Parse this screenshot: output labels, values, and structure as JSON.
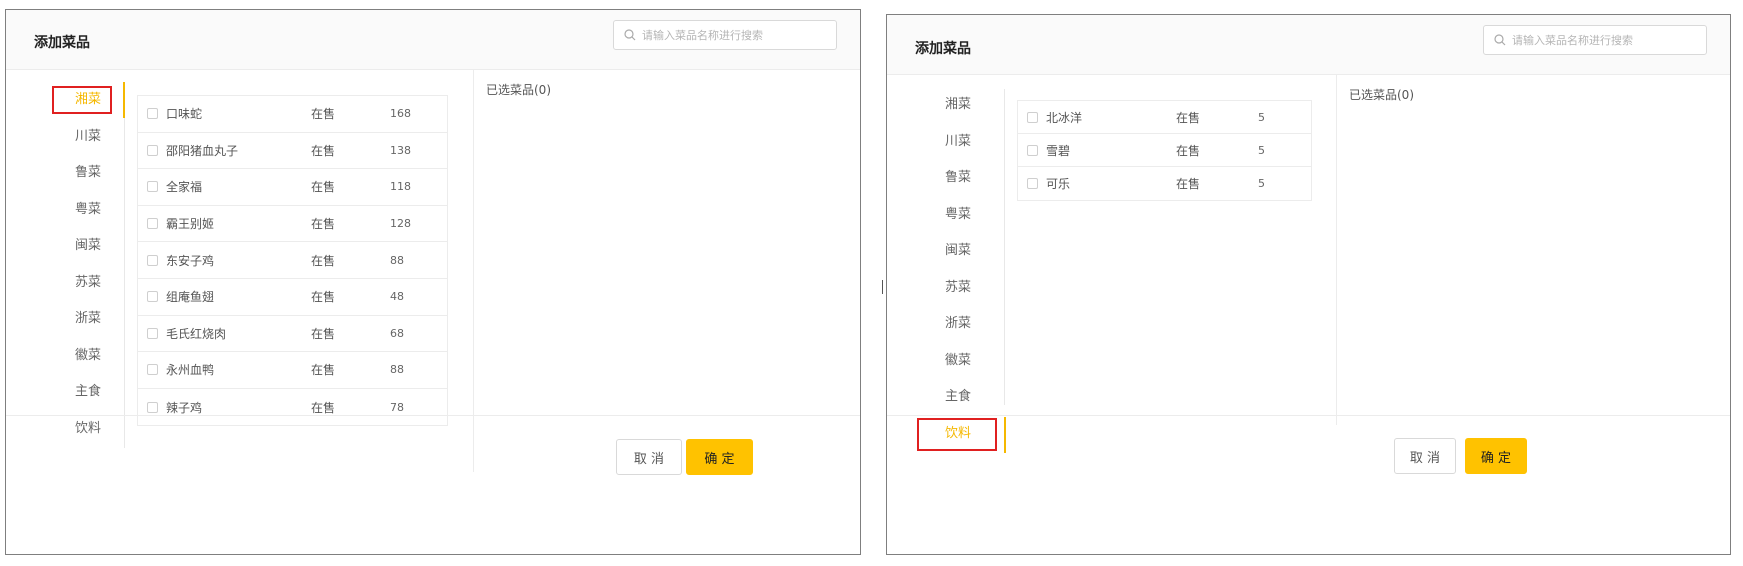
{
  "dialogs": [
    {
      "title": "添加菜品",
      "search_placeholder": "请输入菜品名称进行搜索",
      "categories": [
        "湘菜",
        "川菜",
        "鲁菜",
        "粤菜",
        "闽菜",
        "苏菜",
        "浙菜",
        "徽菜",
        "主食",
        "饮料"
      ],
      "active_category": "湘菜",
      "dishes": [
        {
          "name": "口味蛇",
          "status": "在售",
          "price": "168"
        },
        {
          "name": "邵阳猪血丸子",
          "status": "在售",
          "price": "138"
        },
        {
          "name": "全家福",
          "status": "在售",
          "price": "118"
        },
        {
          "name": "霸王别姬",
          "status": "在售",
          "price": "128"
        },
        {
          "name": "东安子鸡",
          "status": "在售",
          "price": "88"
        },
        {
          "name": "组庵鱼翅",
          "status": "在售",
          "price": "48"
        },
        {
          "name": "毛氏红烧肉",
          "status": "在售",
          "price": "68"
        },
        {
          "name": "永州血鸭",
          "status": "在售",
          "price": "88"
        },
        {
          "name": "辣子鸡",
          "status": "在售",
          "price": "78"
        }
      ],
      "selected_label": "已选菜品(0)",
      "cancel_label": "取 消",
      "ok_label": "确 定"
    },
    {
      "title": "添加菜品",
      "search_placeholder": "请输入菜品名称进行搜索",
      "categories": [
        "湘菜",
        "川菜",
        "鲁菜",
        "粤菜",
        "闽菜",
        "苏菜",
        "浙菜",
        "徽菜",
        "主食",
        "饮料"
      ],
      "active_category": "饮料",
      "dishes": [
        {
          "name": "北冰洋",
          "status": "在售",
          "price": "5"
        },
        {
          "name": "雪碧",
          "status": "在售",
          "price": "5"
        },
        {
          "name": "可乐",
          "status": "在售",
          "price": "5"
        }
      ],
      "selected_label": "已选菜品(0)",
      "cancel_label": "取 消",
      "ok_label": "确 定"
    }
  ],
  "colors": {
    "accent": "#ffc200",
    "active_text": "#f5b800",
    "highlight_box": "#e02020"
  }
}
